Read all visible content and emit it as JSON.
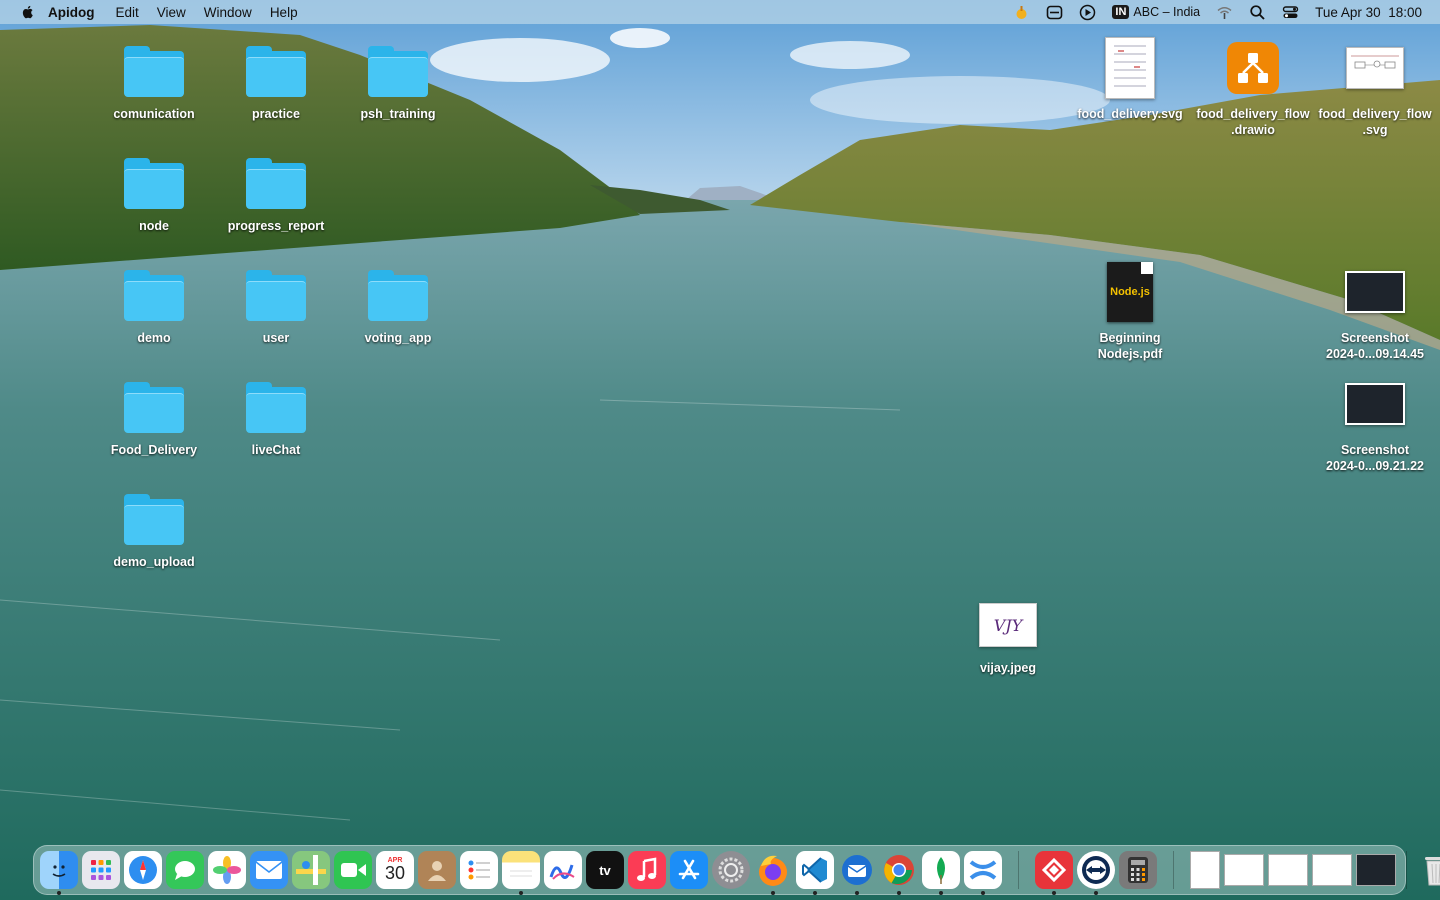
{
  "menubar": {
    "app_name": "Apidog",
    "menus": [
      "Edit",
      "View",
      "Window",
      "Help"
    ],
    "input_source_badge": "IN",
    "input_source_label": "ABC – India",
    "date": "Tue Apr 30",
    "time": "18:00"
  },
  "desktop": {
    "folders": [
      {
        "label": "comunication"
      },
      {
        "label": "practice"
      },
      {
        "label": "psh_training"
      },
      {
        "label": "node"
      },
      {
        "label": "progress_report"
      },
      {
        "label": "demo"
      },
      {
        "label": "user"
      },
      {
        "label": "voting_app"
      },
      {
        "label": "Food_Delivery"
      },
      {
        "label": "liveChat"
      },
      {
        "label": "demo_upload"
      }
    ],
    "files": {
      "svg1": {
        "label": "food_delivery.svg"
      },
      "drawio": {
        "label": "food_delivery_flow\n.drawio",
        "line1": "food_delivery_flow",
        "line2": ".drawio"
      },
      "svg2": {
        "line1": "food_delivery_flow",
        "line2": ".svg"
      },
      "pdf": {
        "line1": "Beginning",
        "line2": "Nodejs.pdf",
        "cover_text": "Node.js"
      },
      "shot1": {
        "line1": "Screenshot",
        "line2": "2024-0...09.14.45"
      },
      "shot2": {
        "line1": "Screenshot",
        "line2": "2024-0...09.21.22"
      },
      "jpeg": {
        "label": "vijay.jpeg",
        "thumb_text": "VJY"
      }
    }
  },
  "dock": {
    "calendar_month": "APR",
    "calendar_day": "30",
    "tv_label": "tv",
    "apps": [
      {
        "name": "finder-icon",
        "color": "#3a9ef5",
        "running": true
      },
      {
        "name": "launchpad-icon",
        "color": "#e8e8ee",
        "running": false
      },
      {
        "name": "safari-icon",
        "color": "#2d8ef0",
        "running": false
      },
      {
        "name": "messages-icon",
        "color": "#34c759",
        "running": false
      },
      {
        "name": "photos-icon",
        "color": "#f5f5f5",
        "running": false
      },
      {
        "name": "mail-icon",
        "color": "#3592f5",
        "running": false
      },
      {
        "name": "maps-icon",
        "color": "#6cc36b",
        "running": false
      },
      {
        "name": "facetime-icon",
        "color": "#2fc552",
        "running": false
      },
      {
        "name": "calendar-icon",
        "color": "#ffffff",
        "running": false
      },
      {
        "name": "contacts-icon",
        "color": "#b08457",
        "running": false
      },
      {
        "name": "reminders-icon",
        "color": "#ffffff",
        "running": false
      },
      {
        "name": "notes-icon",
        "color": "#fbe27a",
        "running": true
      },
      {
        "name": "freeform-icon",
        "color": "#ffffff",
        "running": false
      },
      {
        "name": "appletv-icon",
        "color": "#111111",
        "running": false
      },
      {
        "name": "music-icon",
        "color": "#fb3c55",
        "running": false
      },
      {
        "name": "appstore-icon",
        "color": "#1c8ef7",
        "running": false
      },
      {
        "name": "system-settings-icon",
        "color": "#8e8e93",
        "running": false
      },
      {
        "name": "firefox-icon",
        "color": "#ff8a16",
        "running": true
      },
      {
        "name": "vscode-icon",
        "color": "#1f8ad2",
        "running": true
      },
      {
        "name": "thunderbird-icon",
        "color": "#1d6fd1",
        "running": true
      },
      {
        "name": "chrome-icon",
        "color": "#ffffff",
        "running": true
      },
      {
        "name": "mongodb-compass-icon",
        "color": "#ffffff",
        "running": true
      },
      {
        "name": "xmind-icon",
        "color": "#ffffff",
        "running": true
      },
      {
        "name": "anydesk-icon",
        "color": "#e8343a",
        "running": true
      },
      {
        "name": "teamviewer-icon",
        "color": "#ffffff",
        "running": true
      },
      {
        "name": "calculator-icon",
        "color": "#7a7a7a",
        "running": false
      }
    ]
  }
}
